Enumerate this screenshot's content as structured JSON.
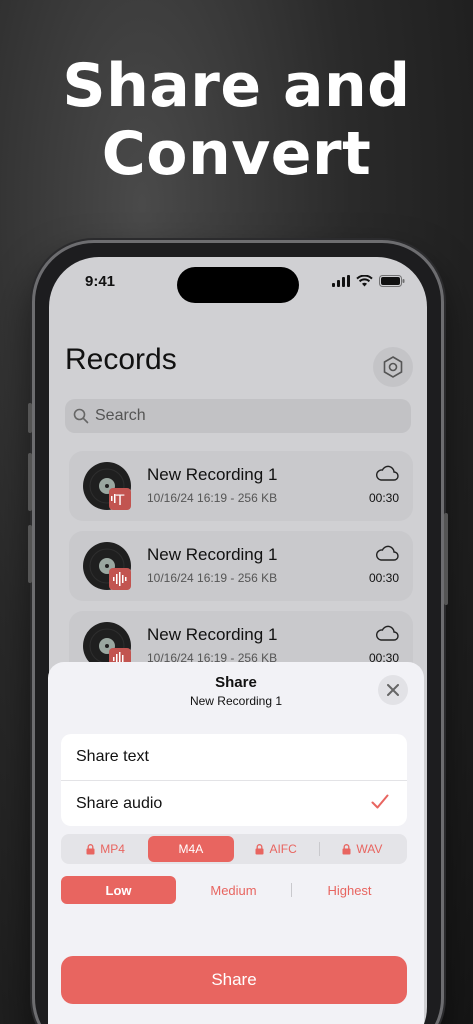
{
  "headline": "Share and Convert",
  "status_bar": {
    "time": "9:41"
  },
  "screen": {
    "title": "Records",
    "search_placeholder": "Search"
  },
  "records": [
    {
      "name": "New Recording 1",
      "meta": "10/16/24 16:19 - 256 KB",
      "duration": "00:30",
      "badge": "text-icon"
    },
    {
      "name": "New Recording 1",
      "meta": "10/16/24 16:19 - 256 KB",
      "duration": "00:30",
      "badge": "waveform-icon"
    },
    {
      "name": "New Recording 1",
      "meta": "10/16/24 16:19 - 256 KB",
      "duration": "00:30",
      "badge": "waveform-icon"
    }
  ],
  "sheet": {
    "title": "Share",
    "subtitle": "New Recording 1",
    "options": [
      {
        "label": "Share text",
        "selected": false
      },
      {
        "label": "Share audio",
        "selected": true
      }
    ],
    "formats": [
      {
        "label": "MP4",
        "locked": true,
        "active": false
      },
      {
        "label": "M4A",
        "locked": false,
        "active": true
      },
      {
        "label": "AIFC",
        "locked": true,
        "active": false
      },
      {
        "label": "WAV",
        "locked": true,
        "active": false
      }
    ],
    "quality": [
      {
        "label": "Low",
        "active": true
      },
      {
        "label": "Medium",
        "active": false
      },
      {
        "label": "Highest",
        "active": false
      }
    ],
    "share_button": "Share"
  },
  "colors": {
    "accent": "#e86560",
    "sheet_bg": "#f2f2f6"
  }
}
